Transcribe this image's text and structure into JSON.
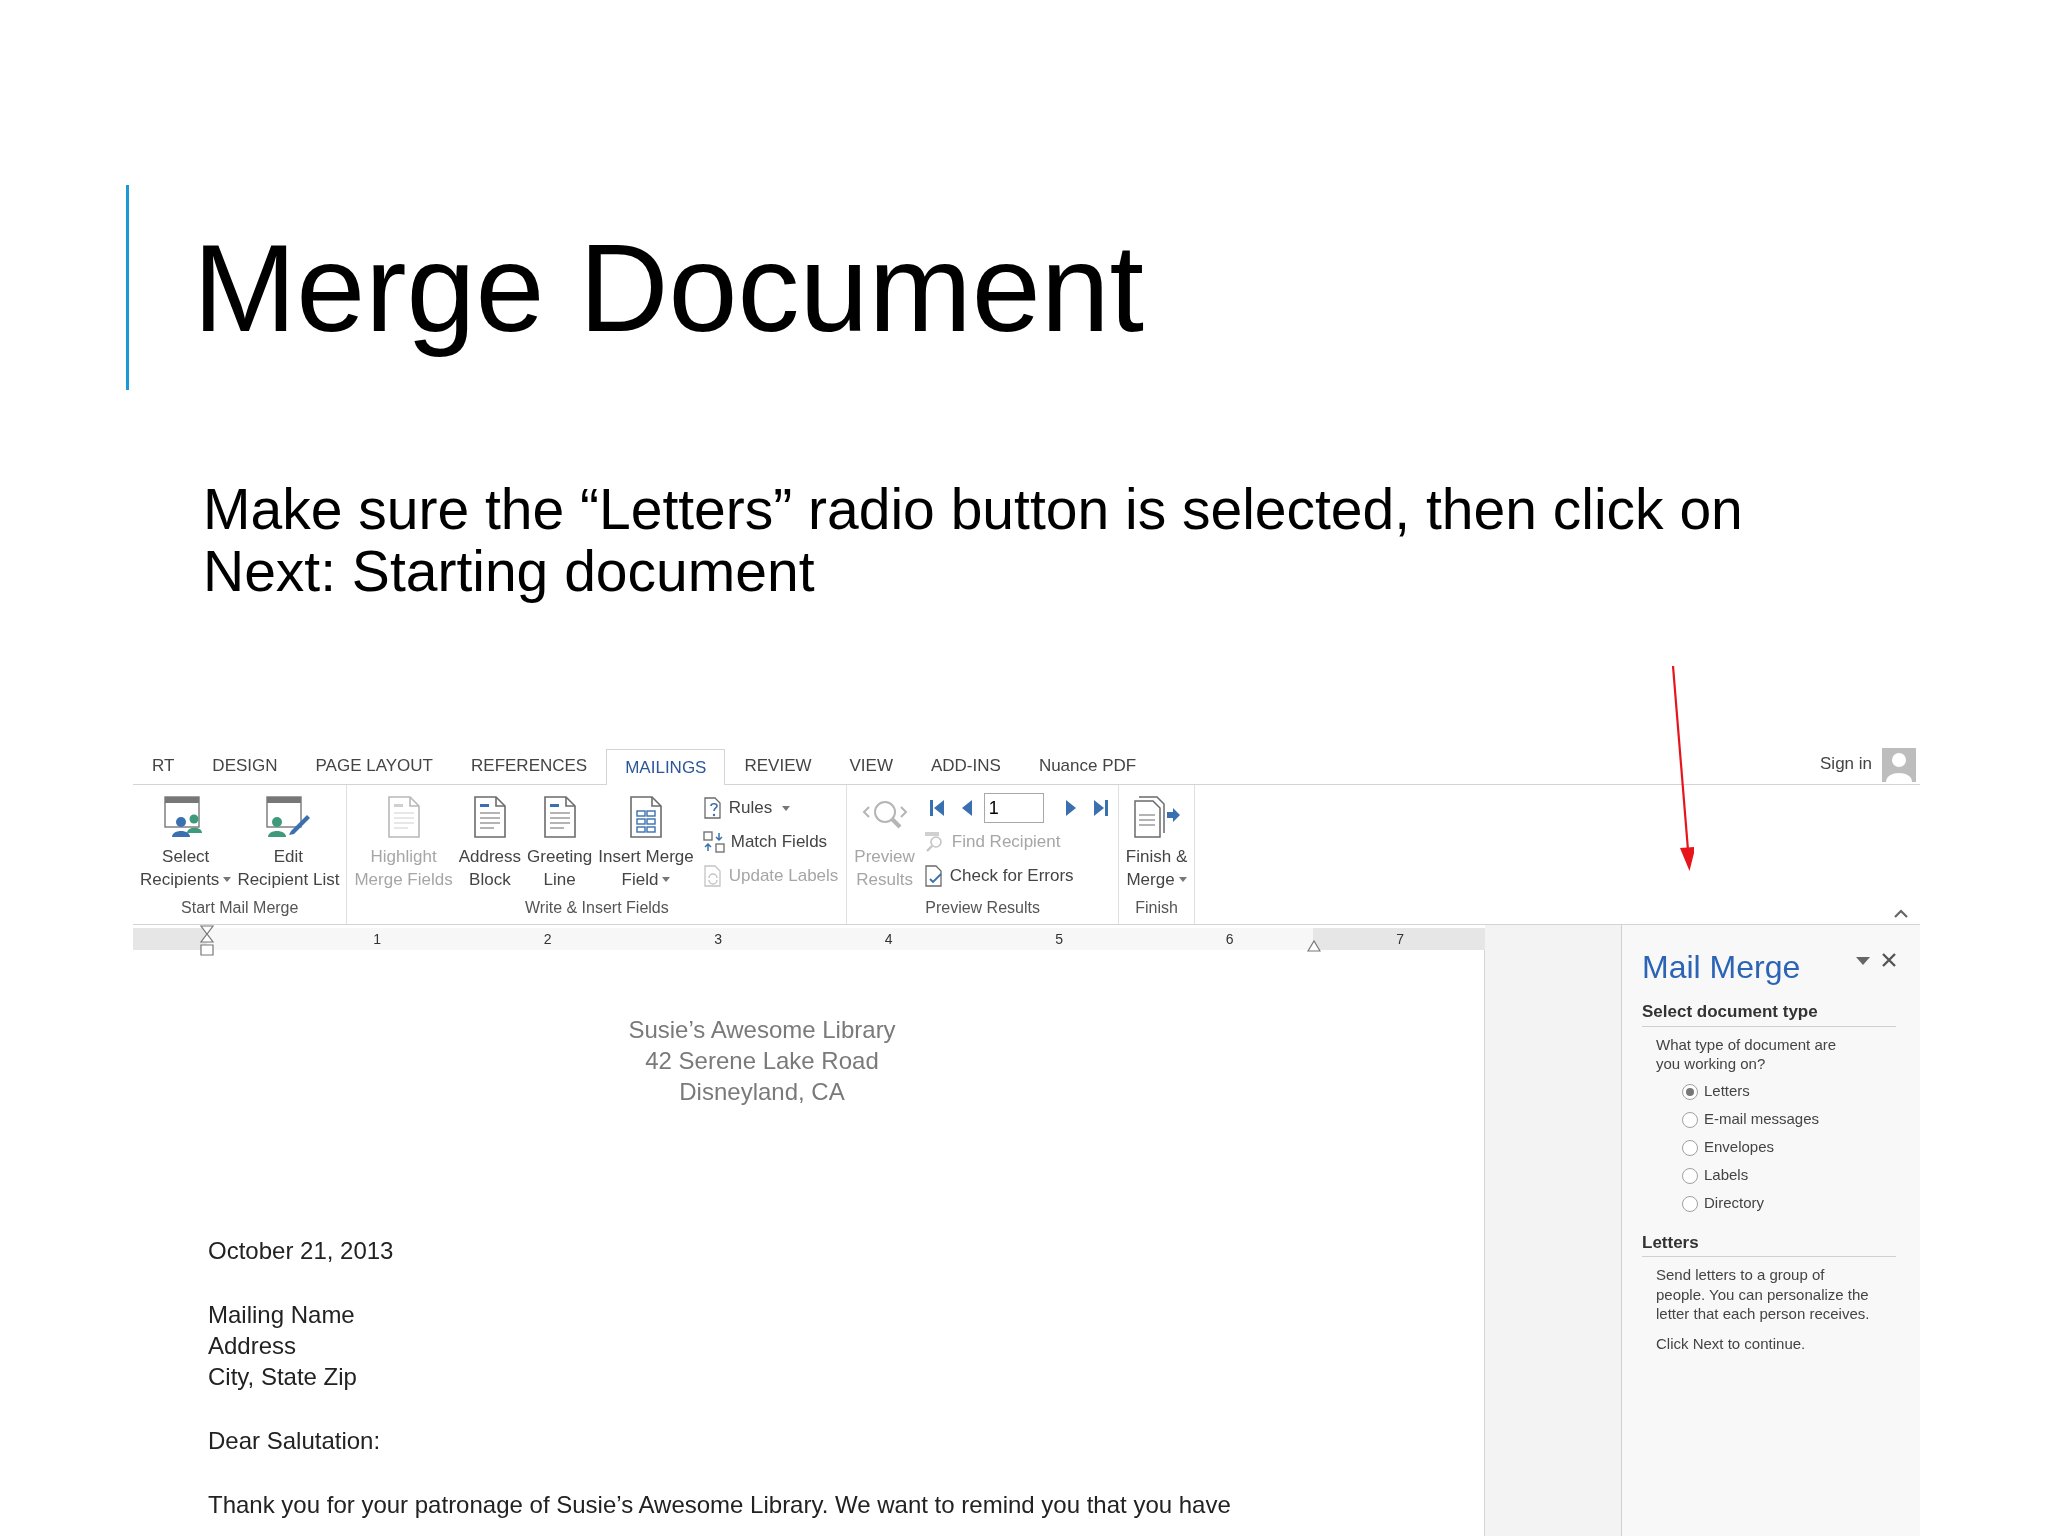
{
  "slide": {
    "title": "Merge Document",
    "instruction": "Make sure the “Letters” radio button is selected, then click on Next: Starting document"
  },
  "word": {
    "tabs": [
      {
        "label": "RT",
        "selected": false
      },
      {
        "label": "DESIGN",
        "selected": false
      },
      {
        "label": "PAGE LAYOUT",
        "selected": false
      },
      {
        "label": "REFERENCES",
        "selected": false
      },
      {
        "label": "MAILINGS",
        "selected": true
      },
      {
        "label": "REVIEW",
        "selected": false
      },
      {
        "label": "VIEW",
        "selected": false
      },
      {
        "label": "ADD-INS",
        "selected": false
      },
      {
        "label": "Nuance PDF",
        "selected": false
      }
    ],
    "sign_in": "Sign in",
    "groups": [
      {
        "label": "Start Mail Merge",
        "large": [
          {
            "lines": [
              "Select",
              "Recipients"
            ],
            "dropdown": true,
            "disabled": false
          },
          {
            "lines": [
              "Edit",
              "Recipient List"
            ],
            "dropdown": false,
            "disabled": false
          }
        ]
      },
      {
        "label": "Write & Insert Fields",
        "large": [
          {
            "lines": [
              "Highlight",
              "Merge Fields"
            ],
            "dropdown": false,
            "disabled": true
          },
          {
            "lines": [
              "Address",
              "Block"
            ],
            "dropdown": false,
            "disabled": false
          },
          {
            "lines": [
              "Greeting",
              "Line"
            ],
            "dropdown": false,
            "disabled": false
          },
          {
            "lines": [
              "Insert Merge",
              "Field"
            ],
            "dropdown": true,
            "disabled": false
          }
        ],
        "small": [
          {
            "kind": "button",
            "label": "Rules",
            "dropdown": true,
            "disabled": false
          },
          {
            "kind": "button",
            "label": "Match Fields",
            "dropdown": false,
            "disabled": false
          },
          {
            "kind": "button",
            "label": "Update Labels",
            "dropdown": false,
            "disabled": true
          }
        ]
      },
      {
        "label": "Preview Results",
        "large": [
          {
            "lines": [
              "Preview",
              "Results"
            ],
            "dropdown": false,
            "disabled": true
          }
        ],
        "small": [
          {
            "kind": "nav",
            "record": "1"
          },
          {
            "kind": "button",
            "label": "Find Recipient",
            "dropdown": false,
            "disabled": true
          },
          {
            "kind": "button",
            "label": "Check for Errors",
            "dropdown": false,
            "disabled": false
          }
        ]
      },
      {
        "label": "Finish",
        "large": [
          {
            "lines": [
              "Finish &",
              "Merge"
            ],
            "dropdown": true,
            "disabled": false
          }
        ]
      }
    ],
    "ruler": [
      "1",
      "2",
      "3",
      "4",
      "5",
      "6",
      "7"
    ],
    "document": {
      "letterhead": [
        "Susie’s Awesome Library",
        "42 Serene Lake Road",
        "Disneyland, CA"
      ],
      "date": "October 21, 2013",
      "address": [
        "Mailing Name",
        "Address",
        "City, State Zip"
      ],
      "salutation": "Dear Salutation:",
      "body": "Thank you for your patronage of Susie’s Awesome Library. We want to remind you that you have"
    },
    "pane": {
      "title": "Mail Merge",
      "section_1": "Select document type",
      "question": "What type of document are you working on?",
      "options": [
        {
          "label": "Letters",
          "selected": true
        },
        {
          "label": "E-mail messages",
          "selected": false
        },
        {
          "label": "Envelopes",
          "selected": false
        },
        {
          "label": "Labels",
          "selected": false
        },
        {
          "label": "Directory",
          "selected": false
        }
      ],
      "section_2": "Letters",
      "description": "Send letters to a group of people. You can personalize the letter that each person receives.",
      "hint": "Click Next to continue."
    }
  }
}
